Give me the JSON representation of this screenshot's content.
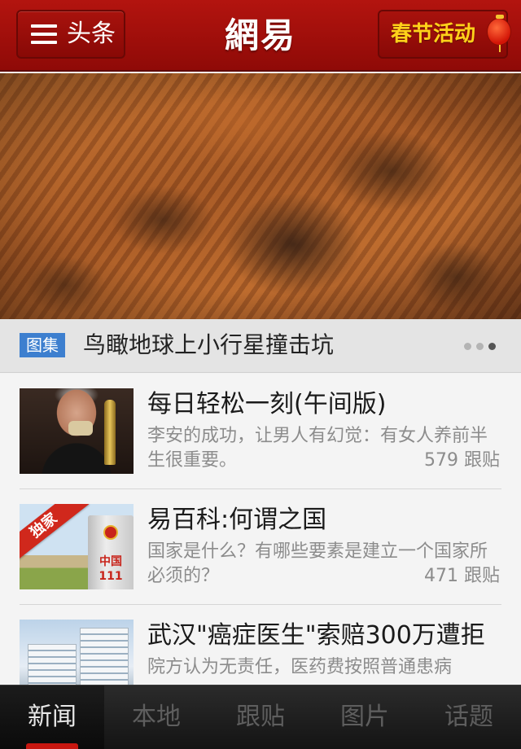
{
  "header": {
    "menu_label": "头条",
    "logo": "網易",
    "event_label": "春节活动"
  },
  "hero": {
    "tag": "图集",
    "title": "鸟瞰地球上小行星撞击坑",
    "pager": {
      "total": 3,
      "active_index": 3
    }
  },
  "news": [
    {
      "title": "每日轻松一刻(午间版)",
      "desc": "李安的成功，让男人有幻觉：有女人养前半生很重要。",
      "count": "579 跟贴"
    },
    {
      "title": "易百科:何谓之国",
      "desc": "国家是什么？有哪些要素是建立一个国家所必须的？",
      "count": "471 跟贴",
      "ribbon": "独家",
      "marker_text": "中国",
      "marker_number": "111"
    },
    {
      "title": "武汉\"癌症医生\"索赔300万遭拒",
      "desc": "院方认为无责任，医药费按照普通患病"
    }
  ],
  "tabs": [
    {
      "label": "新闻",
      "active": true
    },
    {
      "label": "本地",
      "active": false
    },
    {
      "label": "跟贴",
      "active": false
    },
    {
      "label": "图片",
      "active": false
    },
    {
      "label": "话题",
      "active": false
    }
  ],
  "colors": {
    "header_red": "#a8120d",
    "event_yellow": "#ffd11a",
    "tag_blue": "#3d7fcf",
    "tab_indicator": "#c81710"
  },
  "icons": [
    "hamburger-icon",
    "lantern-icon"
  ]
}
